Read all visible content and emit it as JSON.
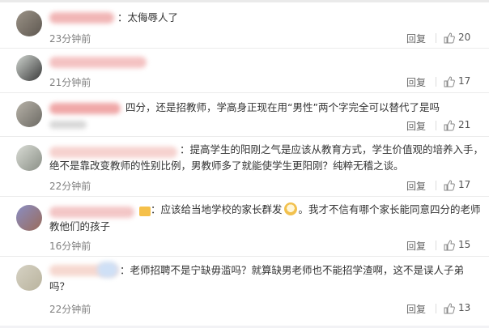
{
  "comments": [
    {
      "text": "：太侮辱人了",
      "time": "23分钟前",
      "reply": "回复",
      "likes": "20"
    },
    {
      "text": "",
      "time": "21分钟前",
      "reply": "回复",
      "likes": "17"
    },
    {
      "text": "四分，还是招教师，学高身正现在用“男性”两个字完全可以替代了是吗",
      "time": "",
      "reply": "回复",
      "likes": "21"
    },
    {
      "text": "：提高学生的阳刚之气是应该从教育方式，学生价值观的培养入手，",
      "text2": "绝不是靠改变教师的性别比例，男教师多了就能使学生更阳刚？纯粹无稽之谈。",
      "time": "22分钟前",
      "reply": "回复",
      "likes": "17"
    },
    {
      "text": "：应该给当地学校的家长群发",
      "text_b": "。我才不信有哪个家长能同意四分的老师",
      "text2": "教他们的孩子",
      "time": "16分钟前",
      "reply": "回复",
      "likes": "15"
    },
    {
      "text": "：老师招聘不是宁缺毋滥吗？就算缺男老师也不能招学渣啊，这不是误人子弟",
      "text2": "吗？",
      "time": "22分钟前",
      "reply": "回复",
      "likes": "13"
    }
  ],
  "colors": {
    "accent": "#eb7350",
    "muted": "#808080"
  }
}
